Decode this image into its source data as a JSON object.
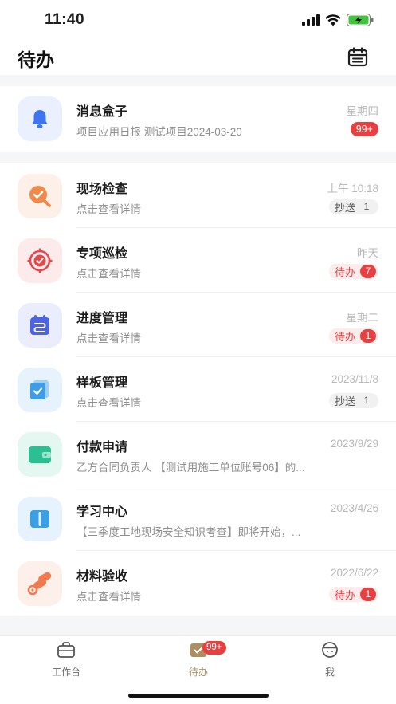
{
  "status_bar": {
    "time": "11:40"
  },
  "header": {
    "title": "待办",
    "calendar_icon": "calendar-icon"
  },
  "message_box": {
    "title": "消息盒子",
    "subtitle": "项目应用日报  测试项目2024-03-20",
    "time": "星期四",
    "badge": "99+",
    "icon": "bell-icon"
  },
  "items": [
    {
      "title": "现场检查",
      "subtitle": "点击查看详情",
      "time": "上午 10:18",
      "tag": {
        "style": "gray",
        "label": "抄送",
        "count": "1"
      },
      "icon": "search-icon",
      "color": "#f08a4b"
    },
    {
      "title": "专项巡检",
      "subtitle": "点击查看详情",
      "time": "昨天",
      "tag": {
        "style": "red",
        "label": "待办",
        "count": "7"
      },
      "icon": "target-icon",
      "color": "#e5474a"
    },
    {
      "title": "进度管理",
      "subtitle": "点击查看详情",
      "time": "星期二",
      "tag": {
        "style": "red",
        "label": "待办",
        "count": "1"
      },
      "icon": "schedule-icon",
      "color": "#4d63e6"
    },
    {
      "title": "样板管理",
      "subtitle": "点击查看详情",
      "time": "2023/11/8",
      "tag": {
        "style": "gray",
        "label": "抄送",
        "count": "1"
      },
      "icon": "template-icon",
      "color": "#3d9de8"
    },
    {
      "title": "付款申请",
      "subtitle": "乙方合同负责人 【测试用施工单位账号06】的...",
      "time": "2023/9/29",
      "tag": null,
      "icon": "wallet-icon",
      "color": "#2cbf94"
    },
    {
      "title": "学习中心",
      "subtitle": "【三季度工地现场安全知识考查】即将开始，...",
      "time": "2023/4/26",
      "tag": null,
      "icon": "book-icon",
      "color": "#3b9fe6"
    },
    {
      "title": "材料验收",
      "subtitle": "点击查看详情",
      "time": "2022/6/22",
      "tag": {
        "style": "red",
        "label": "待办",
        "count": "1"
      },
      "icon": "material-icon",
      "color": "#f07a4e"
    }
  ],
  "tabbar": {
    "tabs": [
      {
        "label": "工作台",
        "icon": "briefcase-icon"
      },
      {
        "label": "待办",
        "icon": "todo-icon",
        "badge": "99+",
        "active": true
      },
      {
        "label": "我",
        "icon": "profile-icon"
      }
    ]
  },
  "colors": {
    "accent_red": "#e64140",
    "active_tab": "#b08d61"
  }
}
